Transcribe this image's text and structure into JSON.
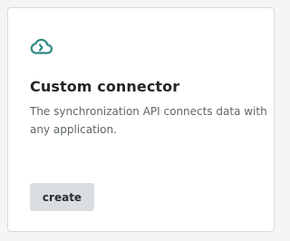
{
  "card": {
    "icon": "cloud-sync-icon",
    "title": "Custom connector",
    "description": "The synchronization API connects data with any application.",
    "button_label": "create"
  },
  "colors": {
    "icon": "#2f8a82",
    "button_bg": "#d9dee1",
    "card_border": "#d7dbde",
    "page_bg": "#f4f5f6"
  }
}
